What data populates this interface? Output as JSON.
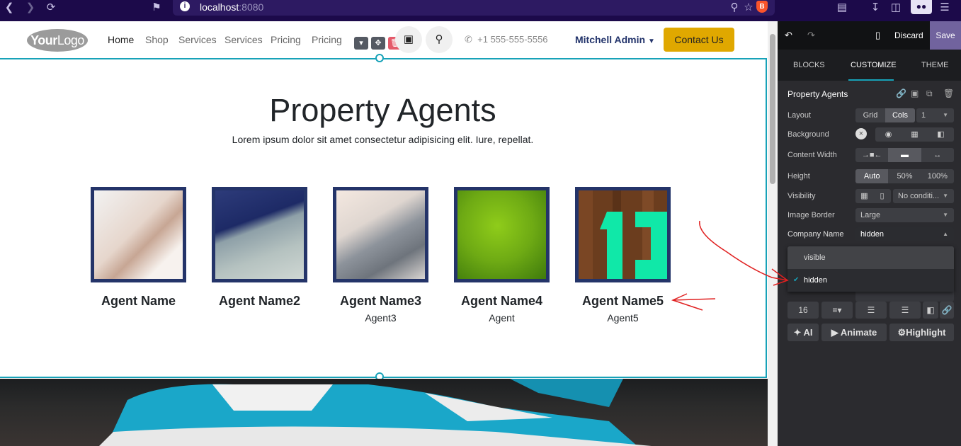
{
  "browser": {
    "host": "localhost",
    "port": ":8080",
    "icons": [
      "back-icon",
      "forward-icon",
      "reload-icon",
      "bookmark-icon",
      "zoom-icon",
      "star-icon",
      "brave-icon",
      "reader-icon",
      "downloads-icon",
      "sidebar-icon",
      "glasses-icon",
      "menu-icon"
    ]
  },
  "header": {
    "logo_bold": "Your",
    "logo_rest": "Logo",
    "nav": [
      "Home",
      "Shop",
      "Services",
      "Services",
      "Pricing",
      "Pricing"
    ],
    "phone": "+1 555-555-5556",
    "user": "Mitchell Admin",
    "contact_label": "Contact Us"
  },
  "section": {
    "title": "Property Agents",
    "subtitle": "Lorem ipsum dolor sit amet consectetur adipisicing elit. Iure, repellat.",
    "agents": [
      {
        "name": "Agent Name",
        "role": ""
      },
      {
        "name": "Agent Name2",
        "role": ""
      },
      {
        "name": "Agent Name3",
        "role": "Agent3"
      },
      {
        "name": "Agent Name4",
        "role": "Agent"
      },
      {
        "name": "Agent Name5",
        "role": "Agent5"
      }
    ]
  },
  "panel": {
    "discard": "Discard",
    "save": "Save",
    "tabs": [
      "BLOCKS",
      "CUSTOMIZE",
      "THEME"
    ],
    "block_title": "Property Agents",
    "options": {
      "layout_label": "Layout",
      "layout_grid": "Grid",
      "layout_cols": "Cols",
      "layout_count": "1",
      "background_label": "Background",
      "content_width_label": "Content Width",
      "height_label": "Height",
      "height_auto": "Auto",
      "height_50": "50%",
      "height_100": "100%",
      "visibility_label": "Visibility",
      "visibility_value": "No conditi...",
      "image_border_label": "Image Border",
      "image_border_value": "Large",
      "company_name_label": "Company Name",
      "company_name_value": "hidden"
    },
    "dropdown": [
      "visible",
      "hidden"
    ],
    "font_size": "16",
    "ai": "AI",
    "animate": "Animate",
    "highlight": "Highlight"
  },
  "colors": {
    "accent": "#17a2b8",
    "save": "#71639e",
    "contact": "#e0a800",
    "frame": "#243469",
    "annotation": "#e02020"
  }
}
